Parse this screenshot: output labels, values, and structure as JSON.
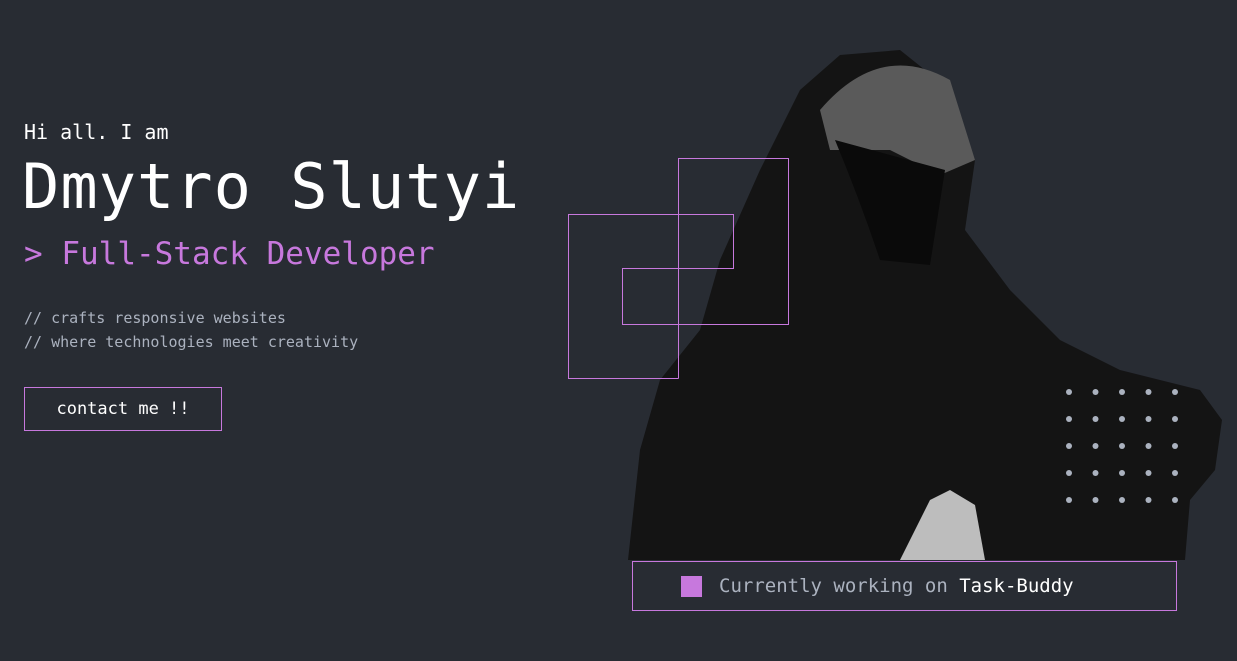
{
  "hero": {
    "greeting": "Hi all. I am",
    "name": "Dmytro Slutyi",
    "role": "> Full-Stack Developer",
    "description": [
      "// crafts responsive websites",
      "// where technologies meet creativity"
    ],
    "contact_button": "contact me !!"
  },
  "status": {
    "label": "Currently working on ",
    "project": "Task-Buddy"
  },
  "colors": {
    "accent": "#c778dd",
    "background": "#282c33",
    "muted": "#abb2bf"
  }
}
